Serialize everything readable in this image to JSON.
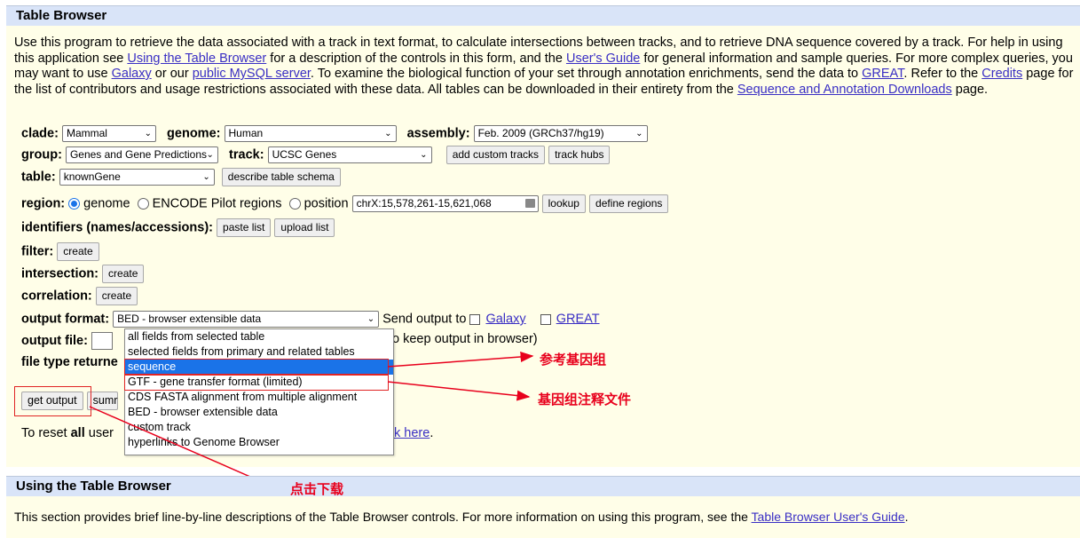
{
  "table_browser": {
    "title": "Table Browser",
    "intro": [
      {
        "t": "Use this program to retrieve the data associated with a track in text format, to calculate intersections between tracks, and to retrieve DNA sequence covered by a track. For help in using this application see "
      },
      {
        "a": "Using the Table Browser"
      },
      {
        "t": " for a description of the controls in this form, and the "
      },
      {
        "a": "User's Guide"
      },
      {
        "t": " for general information and sample queries. For more complex queries, you may want to use "
      },
      {
        "a": "Galaxy"
      },
      {
        "t": " or our "
      },
      {
        "a": "public MySQL server"
      },
      {
        "t": ". To examine the biological function of your set through annotation enrichments, send the data to "
      },
      {
        "a": "GREAT"
      },
      {
        "t": ". Refer to the "
      },
      {
        "a": "Credits"
      },
      {
        "t": " page for the list of contributors and usage restrictions associated with these data. All tables can be downloaded in their entirety from the "
      },
      {
        "a": "Sequence and Annotation Downloads"
      },
      {
        "t": " page."
      }
    ],
    "clade_label": "clade:",
    "clade_value": "Mammal",
    "genome_label": "genome:",
    "genome_value": "Human",
    "assembly_label": "assembly:",
    "assembly_value": "Feb. 2009 (GRCh37/hg19)",
    "group_label": "group:",
    "group_value": "Genes and Gene Predictions",
    "track_label": "track:",
    "track_value": "UCSC Genes",
    "add_custom_tracks": "add custom tracks",
    "track_hubs": "track hubs",
    "table_label": "table:",
    "table_value": "knownGene",
    "describe_schema": "describe table schema",
    "region_label": "region:",
    "region_genome": "genome",
    "region_encode": "ENCODE Pilot regions",
    "region_position": "position",
    "position_value": "chrX:15,578,261-15,621,068",
    "lookup": "lookup",
    "define_regions": "define regions",
    "identifiers_label": "identifiers (names/accessions):",
    "paste_list": "paste list",
    "upload_list": "upload list",
    "filter_label": "filter:",
    "filter_create": "create",
    "intersection_label": "intersection:",
    "intersection_create": "create",
    "correlation_label": "correlation:",
    "correlation_create": "create",
    "output_format_label": "output format:",
    "output_format_value": "BED - browser extensible data",
    "send_output_to": "Send output to",
    "galaxy": "Galaxy",
    "great": "GREAT",
    "output_file_label": "output file:",
    "output_file_hint": "o keep output in browser)",
    "file_type_label": "file type returne",
    "get_output": "get output",
    "summary_partial": "sumr",
    "reset_text_1": "To reset ",
    "reset_text_bold": "all",
    "reset_text_2": " user",
    "reset_link_partial": "k here",
    "reset_tail": ".",
    "format_options": [
      "all fields from selected table",
      "selected fields from primary and related tables",
      "sequence",
      "GTF - gene transfer format (limited)",
      "CDS FASTA alignment from multiple alignment",
      "BED - browser extensible data",
      "custom track",
      "hyperlinks to Genome Browser"
    ],
    "selected_option_index": 2
  },
  "annotations": {
    "ref_genome": "参考基因组",
    "gene_annotation": "基因组注释文件",
    "click_download": "点击下载",
    "color": "#e8001c"
  },
  "using": {
    "title": "Using the Table Browser",
    "text": "This section provides brief line-by-line descriptions of the Table Browser controls. For more information on using this program, see the ",
    "link": "Table Browser User's Guide",
    "tail": "."
  }
}
